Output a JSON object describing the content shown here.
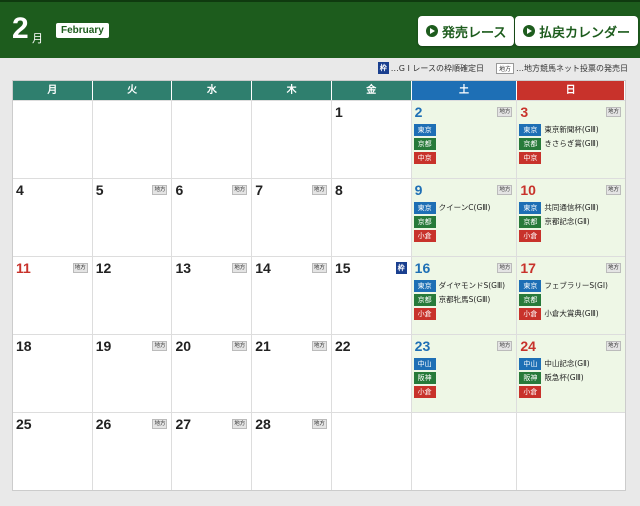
{
  "header": {
    "month_number": "2",
    "month_suffix": "月",
    "month_english": "February",
    "buttons": [
      {
        "label": "発売レース"
      },
      {
        "label": "払戻カレンダー"
      }
    ]
  },
  "legend": {
    "waku_tag": "枠",
    "waku_text": "…G I レースの枠順確定日",
    "chiho_tag": "地方",
    "chiho_text": "…地方競馬ネット投票の発売日"
  },
  "colors": {
    "header_green": "#1d5c1d",
    "weekday_teal": "#2f7f6e",
    "saturday_blue": "#1e6fb5",
    "sunday_red": "#c8322b",
    "waku_navy": "#1a3f8f"
  },
  "weekday_headers": [
    "月",
    "火",
    "水",
    "木",
    "金",
    "土",
    "日"
  ],
  "weeks": [
    [
      {
        "day": ""
      },
      {
        "day": ""
      },
      {
        "day": ""
      },
      {
        "day": ""
      },
      {
        "day": "1"
      },
      {
        "day": "2",
        "chiho": "地方",
        "races": [
          {
            "venue": "東京",
            "color": "blue"
          },
          {
            "venue": "京都",
            "color": "green"
          },
          {
            "venue": "中京",
            "color": "red"
          }
        ]
      },
      {
        "day": "3",
        "chiho": "地方",
        "races": [
          {
            "venue": "東京",
            "color": "blue",
            "name": "東京新聞杯(GⅢ)"
          },
          {
            "venue": "京都",
            "color": "green",
            "name": "きさらぎ賞(GⅢ)"
          },
          {
            "venue": "中京",
            "color": "red"
          }
        ]
      }
    ],
    [
      {
        "day": "4"
      },
      {
        "day": "5",
        "chiho": "地方"
      },
      {
        "day": "6",
        "chiho": "地方"
      },
      {
        "day": "7",
        "chiho": "地方"
      },
      {
        "day": "8"
      },
      {
        "day": "9",
        "chiho": "地方",
        "races": [
          {
            "venue": "東京",
            "color": "blue",
            "name": "クイーンC(GⅢ)"
          },
          {
            "venue": "京都",
            "color": "green"
          },
          {
            "venue": "小倉",
            "color": "red"
          }
        ]
      },
      {
        "day": "10",
        "chiho": "地方",
        "races": [
          {
            "venue": "東京",
            "color": "blue",
            "name": "共同通信杯(GⅢ)"
          },
          {
            "venue": "京都",
            "color": "green",
            "name": "京都記念(GⅡ)"
          },
          {
            "venue": "小倉",
            "color": "red"
          }
        ]
      }
    ],
    [
      {
        "day": "11",
        "chiho": "地方",
        "holiday": true
      },
      {
        "day": "12"
      },
      {
        "day": "13",
        "chiho": "地方"
      },
      {
        "day": "14",
        "chiho": "地方"
      },
      {
        "day": "15",
        "waku": "枠"
      },
      {
        "day": "16",
        "chiho": "地方",
        "races": [
          {
            "venue": "東京",
            "color": "blue",
            "name": "ダイヤモンドS(GⅢ)"
          },
          {
            "venue": "京都",
            "color": "green",
            "name": "京都牝馬S(GⅢ)"
          },
          {
            "venue": "小倉",
            "color": "red"
          }
        ]
      },
      {
        "day": "17",
        "chiho": "地方",
        "races": [
          {
            "venue": "東京",
            "color": "blue",
            "name": "フェブラリーS(GⅠ)"
          },
          {
            "venue": "京都",
            "color": "green"
          },
          {
            "venue": "小倉",
            "color": "red",
            "name": "小倉大賞典(GⅢ)"
          }
        ]
      }
    ],
    [
      {
        "day": "18"
      },
      {
        "day": "19",
        "chiho": "地方"
      },
      {
        "day": "20",
        "chiho": "地方"
      },
      {
        "day": "21",
        "chiho": "地方"
      },
      {
        "day": "22"
      },
      {
        "day": "23",
        "chiho": "地方",
        "races": [
          {
            "venue": "中山",
            "color": "blue"
          },
          {
            "venue": "阪神",
            "color": "green"
          },
          {
            "venue": "小倉",
            "color": "red"
          }
        ]
      },
      {
        "day": "24",
        "chiho": "地方",
        "races": [
          {
            "venue": "中山",
            "color": "blue",
            "name": "中山記念(GⅡ)"
          },
          {
            "venue": "阪神",
            "color": "green",
            "name": "阪急杯(GⅢ)"
          },
          {
            "venue": "小倉",
            "color": "red"
          }
        ]
      }
    ],
    [
      {
        "day": "25"
      },
      {
        "day": "26",
        "chiho": "地方"
      },
      {
        "day": "27",
        "chiho": "地方"
      },
      {
        "day": "28",
        "chiho": "地方"
      },
      {
        "day": ""
      },
      {
        "day": ""
      },
      {
        "day": ""
      }
    ]
  ]
}
